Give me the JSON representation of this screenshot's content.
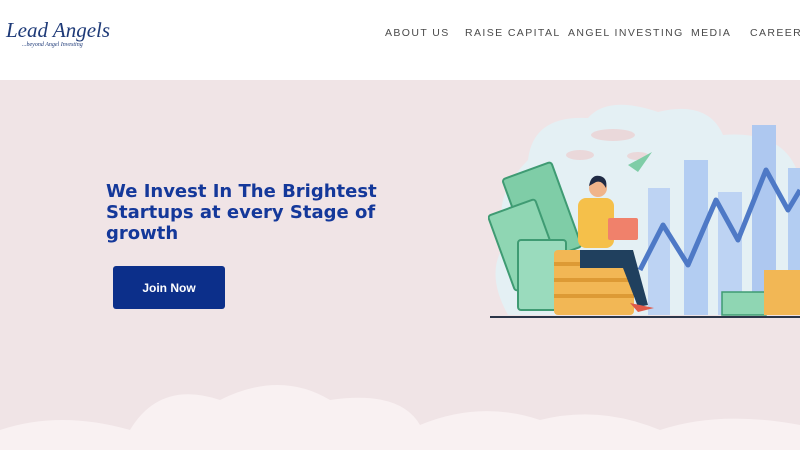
{
  "brand": {
    "name": "Lead Angels",
    "tagline": "...beyond Angel Investing"
  },
  "nav": {
    "items": [
      {
        "label": "ABOUT US"
      },
      {
        "label": "RAISE CAPITAL"
      },
      {
        "label": "ANGEL INVESTING"
      },
      {
        "label": "MEDIA"
      },
      {
        "label": "CAREERS"
      }
    ]
  },
  "hero": {
    "title": "We Invest In The Brightest Startups at every Stage of growth",
    "cta_label": "Join Now"
  },
  "colors": {
    "brand_blue": "#14389a",
    "button_blue": "#0c2f8a",
    "hero_background": "#f0e4e6",
    "nav_text": "#4a4a4a"
  },
  "icons": [
    "investor-illustration-icon",
    "growth-chart-icon",
    "money-stack-icon",
    "paper-plane-icon",
    "cloud-icon"
  ]
}
